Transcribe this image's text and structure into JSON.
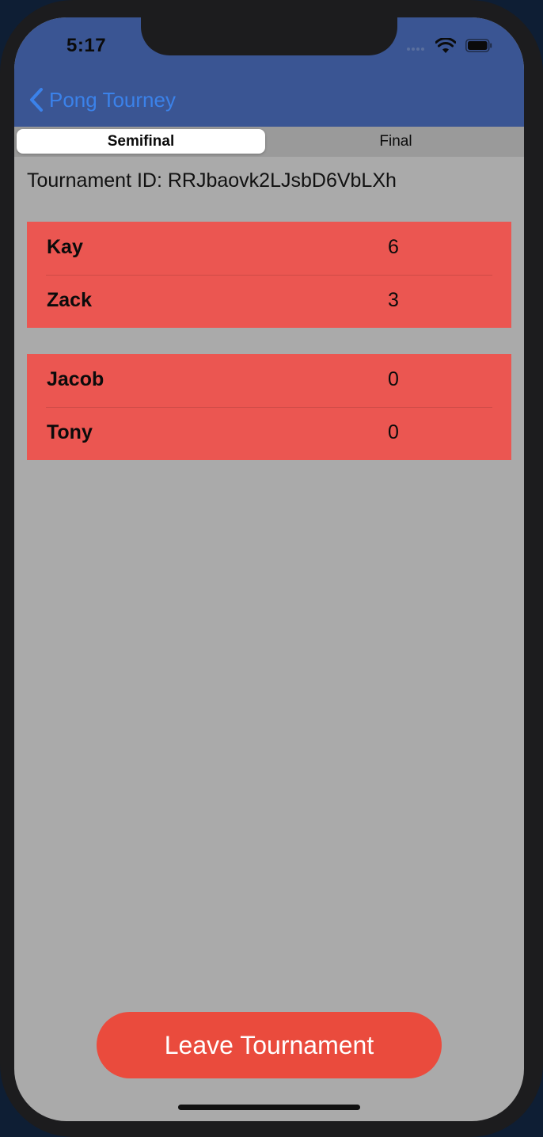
{
  "status_bar": {
    "time": "5:17"
  },
  "nav": {
    "back_label": "Pong Tourney",
    "back_icon": "chevron-left-icon"
  },
  "tabs": [
    {
      "label": "Semifinal",
      "selected": true
    },
    {
      "label": "Final",
      "selected": false
    }
  ],
  "tournament": {
    "id_text": "Tournament ID: RRJbaovk2LJsbD6VbLXh"
  },
  "matches": [
    {
      "players": [
        {
          "name": "Kay",
          "score": "6"
        },
        {
          "name": "Zack",
          "score": "3"
        }
      ]
    },
    {
      "players": [
        {
          "name": "Jacob",
          "score": "0"
        },
        {
          "name": "Tony",
          "score": "0"
        }
      ]
    }
  ],
  "actions": {
    "leave_label": "Leave Tournament"
  },
  "colors": {
    "nav_background": "#3a5593",
    "accent_blue": "#3b82ea",
    "match_card": "#eb5651",
    "leave_button": "#ea4b3d",
    "screen_background": "#aaaaaa"
  }
}
